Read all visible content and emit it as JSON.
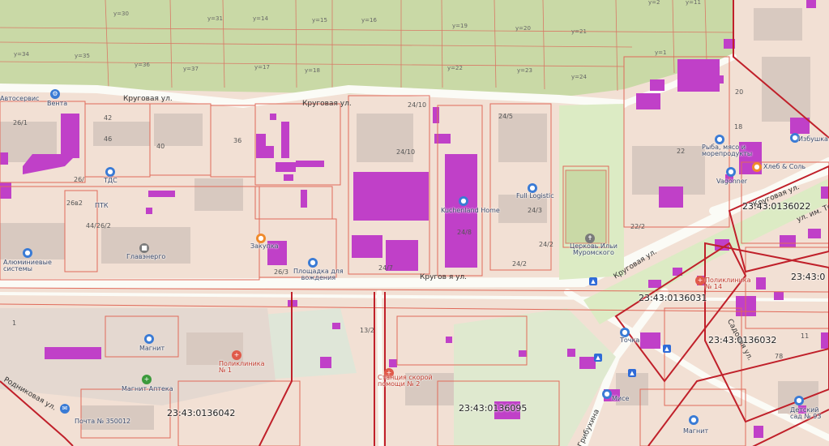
{
  "colors": {
    "parcel_fill": "#f2e0d4",
    "plot_green": "#c9d9a6",
    "park_green": "#dcebc4",
    "building_purple": "#c040c8",
    "parcel_line": "#e06a5a",
    "cadastral_block_line": "#c0202a",
    "road": "#fbfbf6",
    "poi_blue": "#3a7bd5"
  },
  "streets": {
    "krugovaya_nw": "Круговая ул.",
    "krugovaya_n": "Круговая ул.",
    "krugovaya_s": "Кругов   я ул.",
    "krugovaya_e": "Круговая ул.",
    "krugovaya_e2": "Круговая ул.",
    "tovarnaya": "ул. им. Тол",
    "sadovaya": "Садовая ул.",
    "rodnikovaya": "Родниковая ул.",
    "grubuhina": "Грибухина"
  },
  "cadastral_blocks": [
    {
      "id": "blk1",
      "label": "23:43:0136022"
    },
    {
      "id": "blk2",
      "label": "23:43:0136031"
    },
    {
      "id": "blk3",
      "label": "23:43:0"
    },
    {
      "id": "blk4",
      "label": "23:43:0136032"
    },
    {
      "id": "blk5",
      "label": "23:43:0136042"
    },
    {
      "id": "blk6",
      "label": "23:43:0136095"
    }
  ],
  "pois": [
    {
      "id": "avtoservis",
      "label": "Автосервис"
    },
    {
      "id": "venta",
      "label": "Вента"
    },
    {
      "id": "tds",
      "label": "ТДС"
    },
    {
      "id": "ptk",
      "label": "ПТК"
    },
    {
      "id": "alyuminievye",
      "label": "Алюминиевые\nсистемы"
    },
    {
      "id": "glavenergo",
      "label": "Главэнерго"
    },
    {
      "id": "zakupka",
      "label": "Закупка"
    },
    {
      "id": "ploshchadka",
      "label": "Площадка для\nвождения"
    },
    {
      "id": "kuchenland",
      "label": "Kuchenland Home"
    },
    {
      "id": "full_logistic",
      "label": "Full Logistic"
    },
    {
      "id": "tserkov",
      "label": "Церковь Ильи\nМуромского"
    },
    {
      "id": "ryba",
      "label": "Рыба, мясо и\nморепродукты"
    },
    {
      "id": "khleb",
      "label": "Хлеб & Соль"
    },
    {
      "id": "vagonner",
      "label": "Vagonner"
    },
    {
      "id": "poliklinika_n",
      "label": "Поликлиника\n№ 14"
    },
    {
      "id": "magnit_n",
      "label": "Магнит"
    },
    {
      "id": "magnit_apteka",
      "label": "Магнит Аптека"
    },
    {
      "id": "poliklinika_s",
      "label": "Поликлиника\n№ 1"
    },
    {
      "id": "skoraya",
      "label": "Станция скорой\nпомощи № 2"
    },
    {
      "id": "pochta",
      "label": "Почта № 350012"
    },
    {
      "id": "magnit_se",
      "label": "Магнит"
    },
    {
      "id": "detsad",
      "label": "Детский\nсад № 93"
    },
    {
      "id": "mise",
      "label": "Мисе"
    },
    {
      "id": "izbushka",
      "label": "Избушка"
    },
    {
      "id": "tochka",
      "label": "Точка"
    }
  ],
  "parcel_labels": [
    {
      "id": "p30",
      "label": "у=30"
    },
    {
      "id": "p31",
      "label": "у=31"
    },
    {
      "id": "p14",
      "label": "у=14"
    },
    {
      "id": "p15",
      "label": "у=15"
    },
    {
      "id": "p16",
      "label": "у=16"
    },
    {
      "id": "p19",
      "label": "у=19"
    },
    {
      "id": "p20",
      "label": "у=20"
    },
    {
      "id": "p21",
      "label": "у=21"
    },
    {
      "id": "p34",
      "label": "у=34"
    },
    {
      "id": "p35",
      "label": "у=35"
    },
    {
      "id": "p36",
      "label": "у=36"
    },
    {
      "id": "p37",
      "label": "у=37"
    },
    {
      "id": "p17",
      "label": "у=17"
    },
    {
      "id": "p18",
      "label": "у=18"
    },
    {
      "id": "p22",
      "label": "у=22"
    },
    {
      "id": "p23",
      "label": "у=23"
    },
    {
      "id": "p24",
      "label": "у=24"
    },
    {
      "id": "p1",
      "label": "у=1"
    },
    {
      "id": "p2",
      "label": "у=2"
    },
    {
      "id": "p11",
      "label": "у=11"
    },
    {
      "id": "n261",
      "label": "26/1"
    },
    {
      "id": "n42",
      "label": "42"
    },
    {
      "id": "n46",
      "label": "46"
    },
    {
      "id": "n40",
      "label": "40"
    },
    {
      "id": "n36",
      "label": "36"
    },
    {
      "id": "n26",
      "label": "26/"
    },
    {
      "id": "n262",
      "label": "26в2"
    },
    {
      "id": "n442",
      "label": "44/26/2"
    },
    {
      "id": "n263",
      "label": "26/3"
    },
    {
      "id": "n2410",
      "label": "24/10"
    },
    {
      "id": "n2410b",
      "label": "24/10"
    },
    {
      "id": "n245",
      "label": "24/5"
    },
    {
      "id": "n243",
      "label": "24/3"
    },
    {
      "id": "n248",
      "label": "24/8"
    },
    {
      "id": "n242",
      "label": "24/2"
    },
    {
      "id": "n242b",
      "label": "24/2"
    },
    {
      "id": "n247",
      "label": "24/7"
    },
    {
      "id": "n20",
      "label": "20"
    },
    {
      "id": "n22",
      "label": "22"
    },
    {
      "id": "n222",
      "label": "22/2"
    },
    {
      "id": "n18",
      "label": "18"
    },
    {
      "id": "n78",
      "label": "78"
    },
    {
      "id": "n11",
      "label": "11"
    },
    {
      "id": "n132",
      "label": "13/2"
    },
    {
      "id": "n1",
      "label": "1"
    }
  ]
}
